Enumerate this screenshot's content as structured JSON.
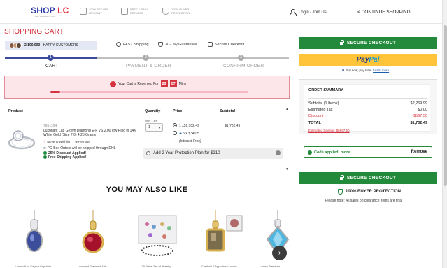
{
  "header": {
    "logo_shop": "SHOP",
    "logo_lc": " LC",
    "logo_tagline": "DELIVERING JOY",
    "badges": [
      {
        "icon": "secure-payment-icon",
        "text": "100% SECURE PAYMENT"
      },
      {
        "icon": "truck-icon",
        "text": "FREE & EASY RETURNS"
      },
      {
        "icon": "shield-icon",
        "text": "100% BUYER PROTECTION"
      }
    ],
    "login": "Login / Join Us",
    "continue": "< CONTINUE SHOPPING"
  },
  "cart": {
    "title": "SHOPPING CART",
    "happy_count": "2,100,000+",
    "happy_label": "HAPPY CUSTOMERS",
    "perks": [
      "FAST Shipping",
      "30-Day Guarantee",
      "Secure Checkout"
    ],
    "steps": [
      {
        "num": "1",
        "label": "CART"
      },
      {
        "num": "2",
        "label": "PAYMENT & ORDER"
      },
      {
        "num": "3",
        "label": "CONFIRM ORDER"
      }
    ],
    "reserve": {
      "prefix": "Your Cart is Reserved For",
      "minutes_a": "29",
      "minutes_b": "07",
      "suffix": "Mins",
      "progress": 0.05
    },
    "columns": {
      "product": "Product",
      "quantity": "Quantity",
      "price": "Price:",
      "subtotal": "Subtotal"
    },
    "item": {
      "sku": "7951104",
      "name": "Luxuriant Lab Grown Diamond E-F VS 2.00 ctw Ring in 14K White Gold (Size 7.0) 4.25 Grams",
      "move_wishlist": "Move to Wishlist",
      "remove": "Remove",
      "po_box": "PO Box Orders will be shipped through DHL",
      "discount": "25% Discount Applied!",
      "free_shipping": "Free Shipping Applied!",
      "qty_label": "Only 1 left",
      "qty": "1",
      "price_full": "1 x$1,702.49",
      "price_installments": "5 x $340.5",
      "interest": "(Interest Free)",
      "subtotal": "$1,702.49",
      "protection_plan": "Add 2 Year Protection Plan for $210"
    }
  },
  "recommend": {
    "title": "YOU MAY ALSO LIKE",
    "products": [
      "Luxoro AAA Ceylon Sapphire...",
      "Luxuriant Diamond 10k...",
      "30 Piece Set of Jewelry...",
      "Certified & Appraised Luxoro...",
      "Luxoro Premium..."
    ]
  },
  "checkout": {
    "secure_checkout": "SECURE CHECKOUT",
    "paypal_a": "Pay",
    "paypal_b": "Pal",
    "pay_later_text": "Buy now, pay later.",
    "learn_more": "Learn more",
    "summary": {
      "title": "ORDER SUMMARY",
      "subtotal_label": "Subtotal (1 Items)",
      "subtotal": "$2,269.99",
      "tax_label": "Estimated Tax",
      "tax": "$0.00",
      "discount_label": "Discount",
      "discount": "-$567.50",
      "total_label": "TOTAL",
      "total": "$1,702.49",
      "savings": "Estimated Savings: $6997.50"
    },
    "coupon_text": "Code applied: more",
    "coupon_remove": "Remove",
    "buyer_protection": "100% BUYER PROTECTION",
    "clearance_note": "Please note: All sales on clearance items are final"
  },
  "colors": {
    "brand_red": "#d4333f",
    "brand_blue": "#2b3aa8",
    "checkout_green": "#23893b",
    "paypal_yellow": "#ffc439"
  }
}
